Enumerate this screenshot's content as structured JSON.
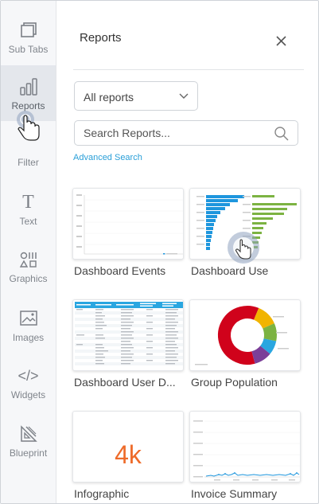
{
  "rail": {
    "items": [
      {
        "label": "Sub Tabs",
        "icon": "sub-tabs-icon"
      },
      {
        "label": "Reports",
        "icon": "bar-chart-icon",
        "active": true
      },
      {
        "label": "Filter",
        "icon": "filter-icon"
      },
      {
        "label": "Text",
        "icon": "text-icon",
        "glyph": "T"
      },
      {
        "label": "Graphics",
        "icon": "graphics-icon"
      },
      {
        "label": "Images",
        "icon": "image-icon"
      },
      {
        "label": "Widgets",
        "icon": "code-icon",
        "glyph": "</>"
      },
      {
        "label": "Blueprint",
        "icon": "blueprint-icon"
      }
    ]
  },
  "panel": {
    "title": "Reports",
    "select_value": "All reports",
    "search_placeholder": "Search Reports...",
    "advanced_search": "Advanced Search"
  },
  "reports": [
    {
      "name": "Dashboard Events",
      "thumb": "line-chart"
    },
    {
      "name": "Dashboard Use",
      "thumb": "bar-charts"
    },
    {
      "name": "Dashboard User D...",
      "thumb": "table"
    },
    {
      "name": "Group Population",
      "thumb": "donut"
    },
    {
      "name": "Infographic",
      "thumb": "number",
      "value": "4k"
    },
    {
      "name": "Invoice Summary",
      "thumb": "area-chart"
    }
  ],
  "colors": {
    "accent": "#2a9fd8",
    "infographic": "#ee6b2a",
    "bar_blue": "#1e96dd",
    "bar_green": "#7cb342",
    "donut": [
      "#7b3f98",
      "#2aa6e0",
      "#7cb342",
      "#f1b400",
      "#ee6b2a",
      "#d0021b"
    ]
  }
}
